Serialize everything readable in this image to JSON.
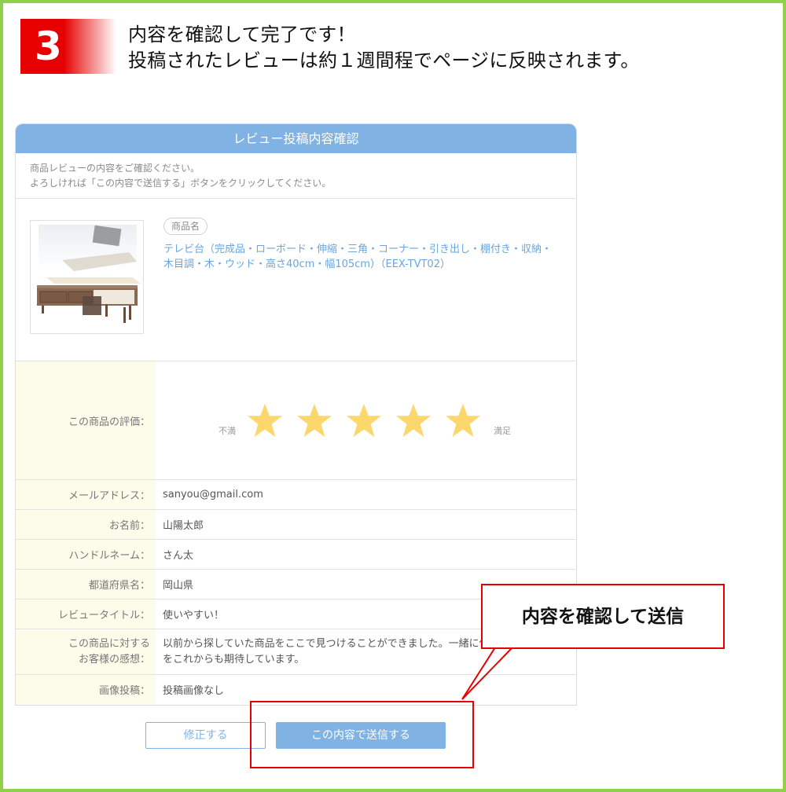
{
  "step": {
    "number": "3",
    "line1": "内容を確認して完了です！",
    "line2": "投稿されたレビューは約１週間程でページに反映されます。"
  },
  "panel": {
    "title": "レビュー投稿内容確認",
    "intro_line1": "商品レビューの内容をご確認ください。",
    "intro_line2": "よろしければ「この内容で送信する」ボタンをクリックしてください。",
    "product_badge": "商品名",
    "product_name_line1": "テレビ台（完成品・ローボード・伸縮・三角・コーナー・引き出し・棚付き・収納・",
    "product_name_line2": "木目調・木・ウッド・高さ40cm・幅105cm）（EEX-TVT02）"
  },
  "rating": {
    "label": "この商品の評価：",
    "low_label": "不満",
    "high_label": "満足",
    "value": 5,
    "max": 5,
    "star_color": "#fcd76b"
  },
  "fields": [
    {
      "label": "メールアドレス：",
      "value": "sanyou@gmail.com"
    },
    {
      "label": "お名前：",
      "value": "山陽太郎"
    },
    {
      "label": "ハンドルネーム：",
      "value": "さん太"
    },
    {
      "label": "都道府県名：",
      "value": "岡山県"
    },
    {
      "label": "レビュータイトル：",
      "value": "使いやすい！"
    },
    {
      "label_line1": "この商品に対する",
      "label_line2": "お客様の感想：",
      "value_line1": "以前から探していた商品をここで見つけることができました。一緒に使",
      "value_line2": "をこれからも期待しています。"
    },
    {
      "label": "画像投稿：",
      "value": "投稿画像なし"
    }
  ],
  "buttons": {
    "edit": "修正する",
    "submit": "この内容で送信する"
  },
  "callout": {
    "text": "内容を確認して送信"
  },
  "colors": {
    "accent": "#80b3e3",
    "frame": "#8fd14a",
    "annotation": "#e60000",
    "label_bg": "#fdfbea"
  }
}
